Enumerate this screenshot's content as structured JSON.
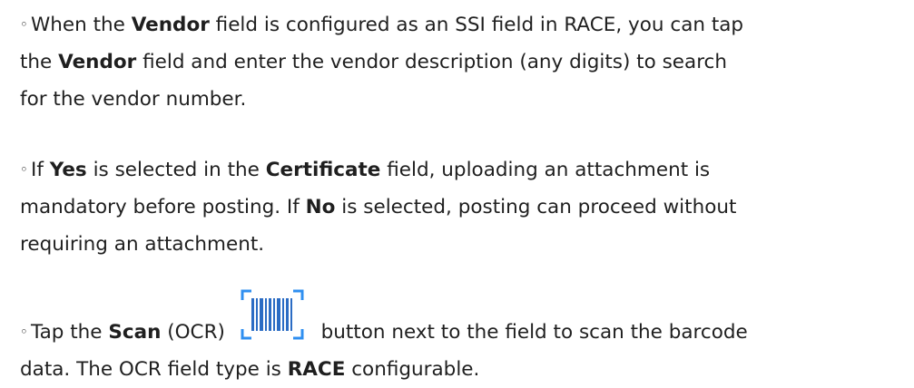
{
  "items": [
    {
      "bullet": "◦",
      "t1": "When the ",
      "b1": "Vendor",
      "t2": " field is configured as an SSI field in RACE, you can tap",
      "t3": "the ",
      "b2": "Vendor",
      "t4": " field and enter the vendor description (any digits) to search",
      "t5": "for the vendor number."
    },
    {
      "bullet": "◦",
      "t1": "If ",
      "b1": "Yes",
      "t2": " is selected in the ",
      "b2": "Certificate",
      "t3": " field, uploading an attachment is",
      "t4": "mandatory before posting. If ",
      "b3": "No",
      "t5": " is selected, posting can proceed without",
      "t6": "requiring an attachment."
    },
    {
      "bullet": "◦",
      "t1": "Tap the ",
      "b1": "Scan",
      "t2": " (OCR) ",
      "icon": "barcode-scan-icon",
      "t3": " button next to the field to scan the barcode",
      "t4": "data. The OCR field type is ",
      "b2": "RACE",
      "t5": " configurable."
    }
  ],
  "colors": {
    "text": "#1f1f1f",
    "icon_blue": "#2b6cc4",
    "icon_frame": "#2f8ff0"
  }
}
